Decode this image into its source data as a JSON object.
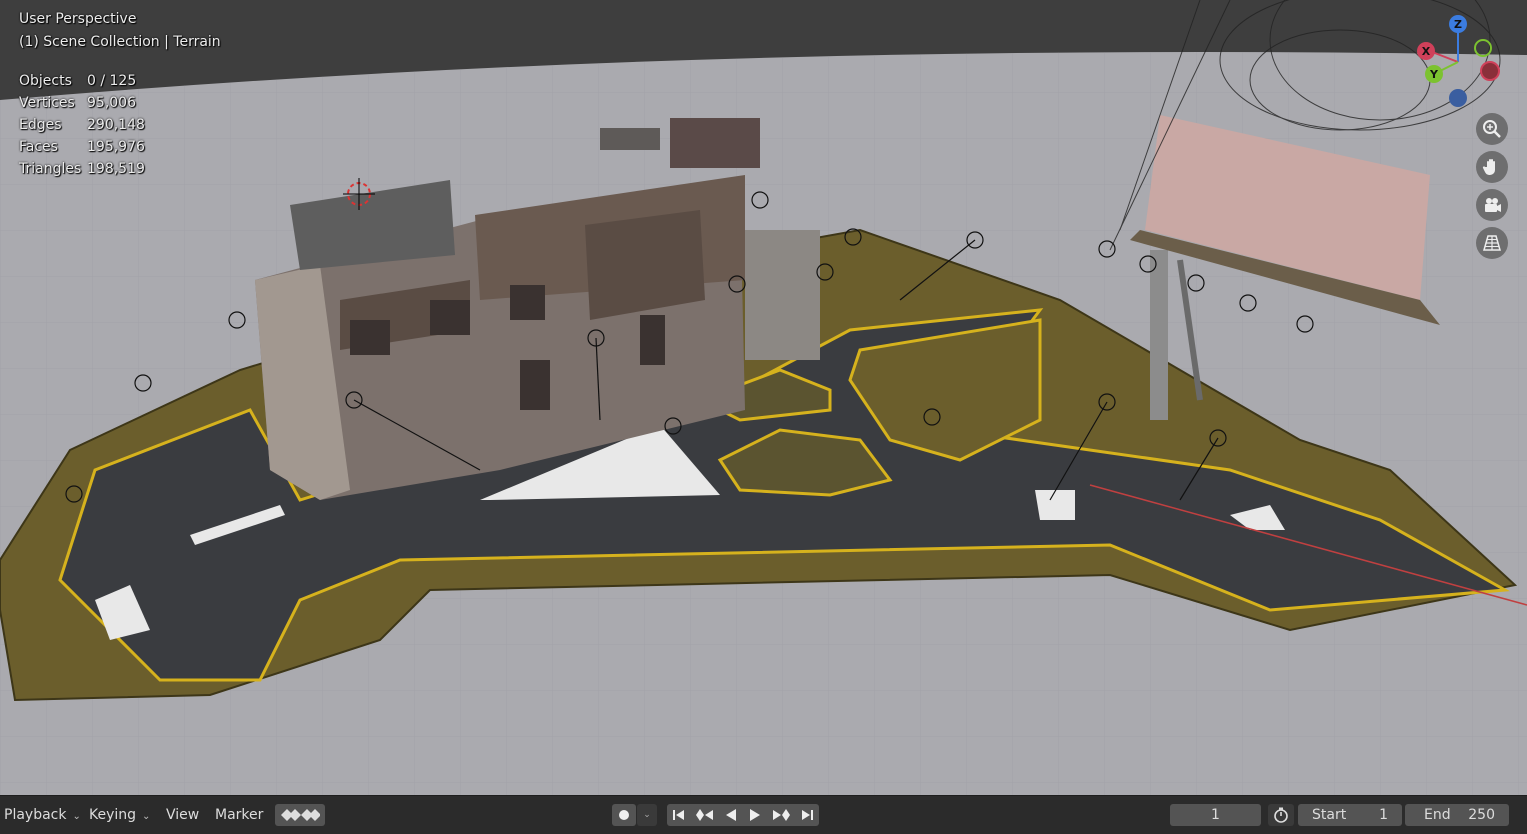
{
  "viewport": {
    "mode": "User Perspective",
    "collection": "(1) Scene Collection | Terrain",
    "stats": [
      {
        "label": "Objects",
        "value": "0 / 125"
      },
      {
        "label": "Vertices",
        "value": "95,006"
      },
      {
        "label": "Edges",
        "value": "290,148"
      },
      {
        "label": "Faces",
        "value": "195,976"
      },
      {
        "label": "Triangles",
        "value": "198,519"
      }
    ],
    "gizmo": {
      "z": "Z",
      "x": "X",
      "y": "Y"
    },
    "nav_icons": [
      "zoom-icon",
      "hand-pan-icon",
      "camera-icon",
      "perspective-grid-icon"
    ]
  },
  "timeline": {
    "playback": "Playback",
    "keying": "Keying",
    "view": "View",
    "marker": "Marker",
    "current_frame": "1",
    "start_label": "Start",
    "start_value": "1",
    "end_label": "End",
    "end_value": "250"
  },
  "colors": {
    "grid": "#a9a9ae",
    "terrain": "#6b5e2c",
    "road": "#3a3c40",
    "road_line": "#d6b21d",
    "building": "#807570",
    "billboard": "#c9a8a4",
    "header": "#3c3c3c",
    "timeline": "#2b2b2b"
  }
}
